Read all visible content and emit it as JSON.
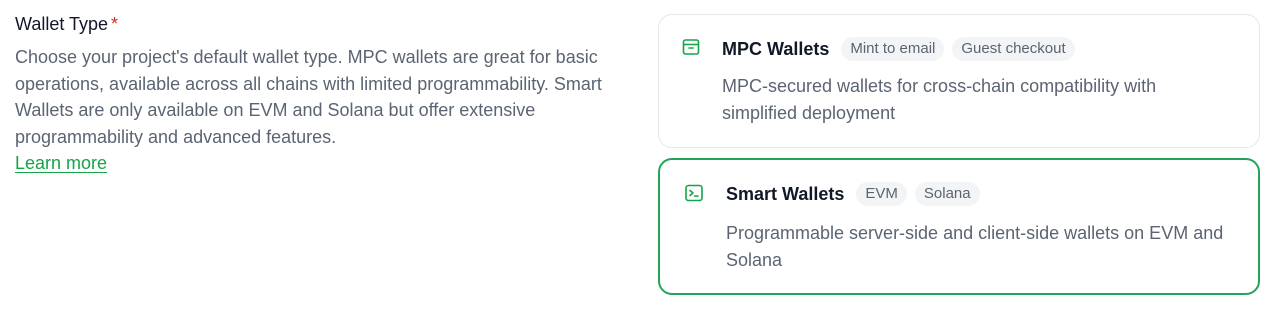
{
  "field": {
    "label": "Wallet Type",
    "required_marker": "*",
    "description": "Choose your project's default wallet type. MPC wallets are great for basic operations, available across all chains with limited programmability. Smart Wallets are only available on EVM and Solana but offer extensive programmability and advanced features.",
    "learn_more": "Learn more"
  },
  "options": [
    {
      "title": "MPC Wallets",
      "icon": "wallet-icon",
      "tags": [
        "Mint to email",
        "Guest checkout"
      ],
      "description": "MPC-secured wallets for cross-chain compatibility with simplified deployment",
      "selected": false
    },
    {
      "title": "Smart Wallets",
      "icon": "terminal-icon",
      "tags": [
        "EVM",
        "Solana"
      ],
      "description": "Programmable server-side and client-side wallets on EVM and Solana",
      "selected": true
    }
  ],
  "colors": {
    "accent": "#16a34a",
    "required": "#dc2626",
    "selected_border": "#22a55a",
    "muted_text": "#5b6472",
    "tag_bg": "#f3f4f6"
  }
}
